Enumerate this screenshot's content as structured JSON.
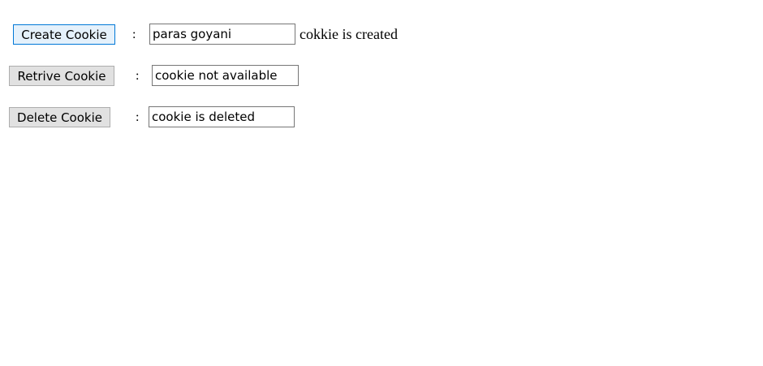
{
  "rows": {
    "create": {
      "button_label": "Create Cookie",
      "separator": ":",
      "field_value": "paras goyani",
      "status_text": "cokkie is created"
    },
    "retrieve": {
      "button_label": "Retrive Cookie",
      "separator": ":",
      "field_value": "cookie not available"
    },
    "delete": {
      "button_label": "Delete Cookie",
      "separator": ":",
      "field_value": "cookie is deleted"
    }
  },
  "colors": {
    "focused_button_border": "#0078d7",
    "focused_button_background": "#e5f1fb",
    "button_background": "#e1e1e1",
    "input_border": "#767676"
  }
}
